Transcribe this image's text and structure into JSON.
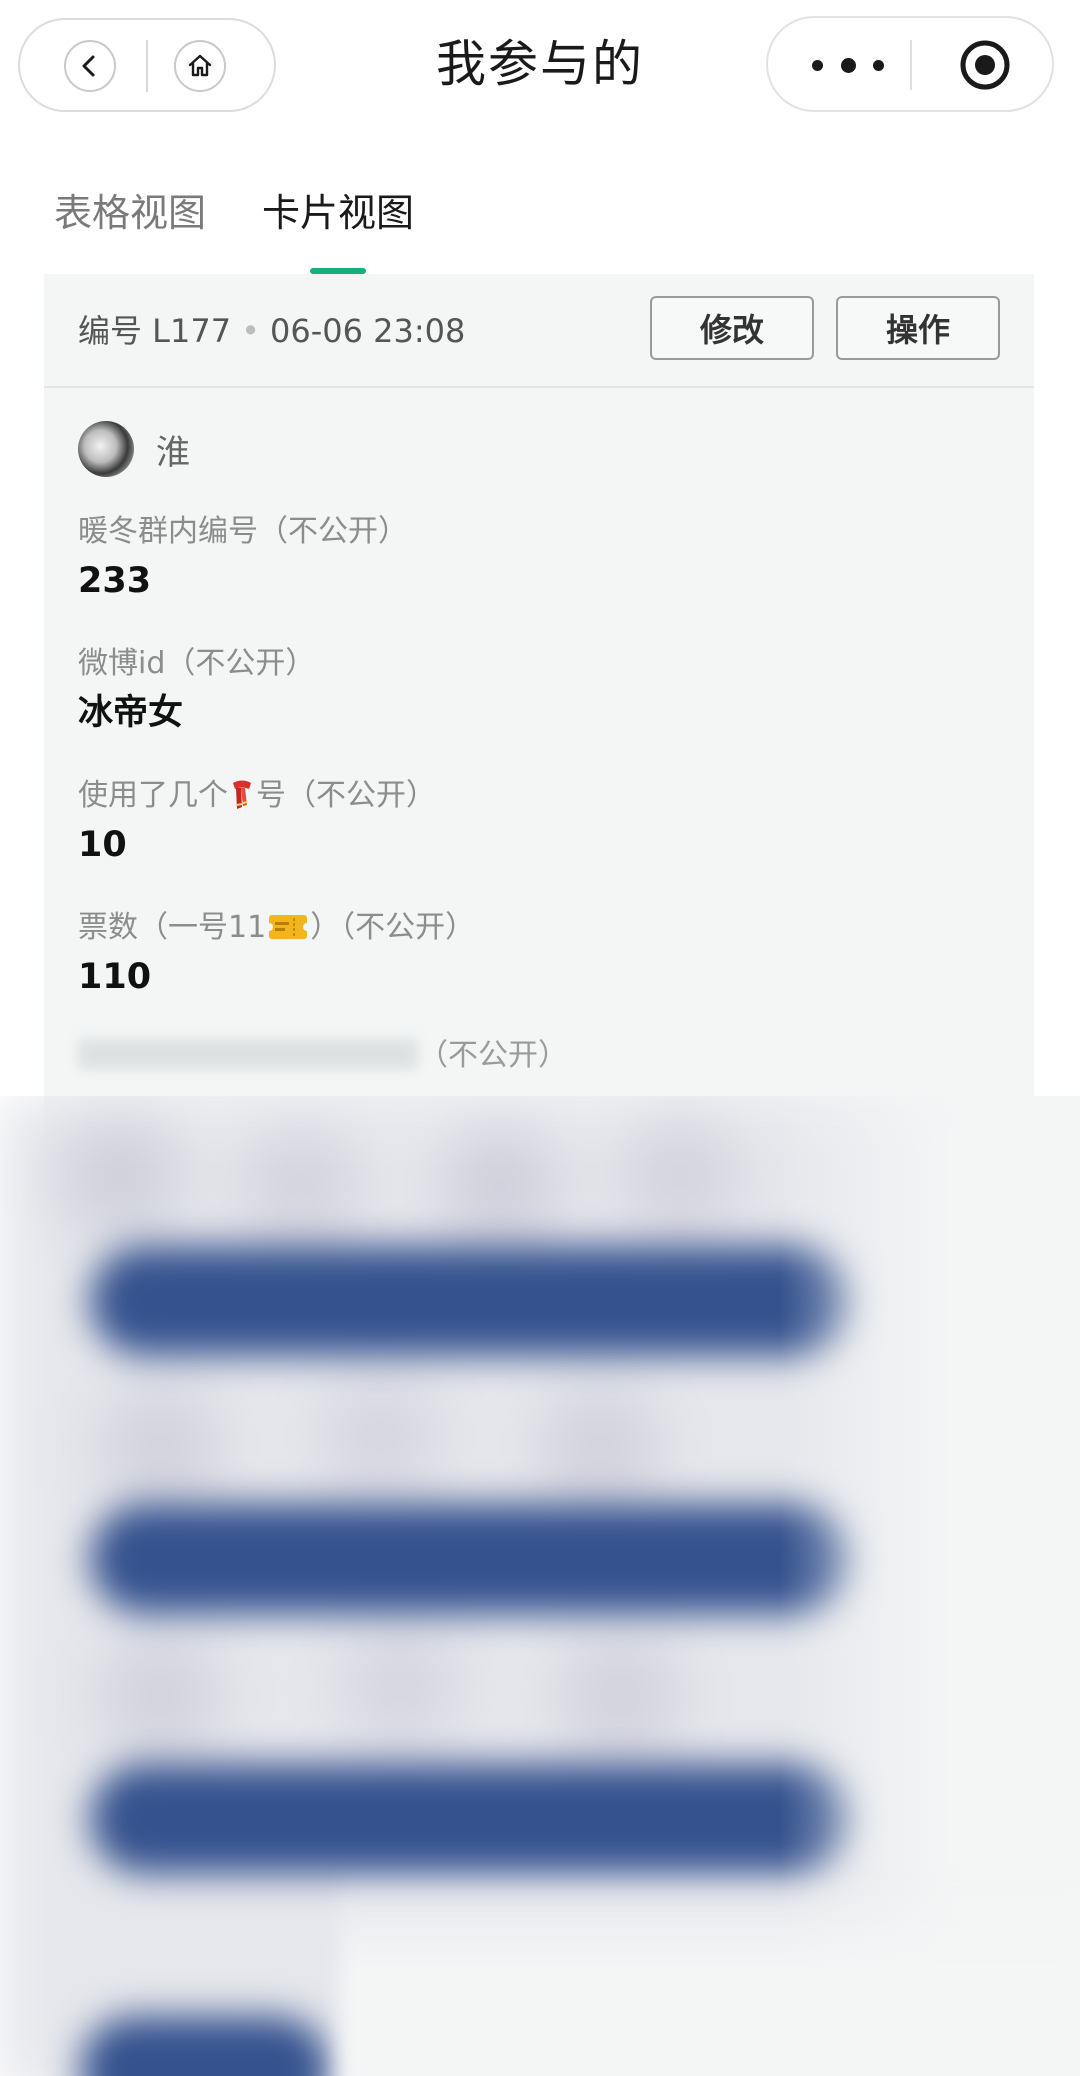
{
  "nav": {
    "title": "我参与的"
  },
  "tabs": [
    {
      "label": "表格视图",
      "active": false
    },
    {
      "label": "卡片视图",
      "active": true
    }
  ],
  "accent_color": "#16b07a",
  "card": {
    "meta_id": "编号 L177",
    "meta_separator": "•",
    "meta_time": "06-06 23:08",
    "edit_label": "修改",
    "ops_label": "操作",
    "user_name": "淮",
    "fields": [
      {
        "label": "暖冬群内编号（不公开）",
        "value": "233"
      },
      {
        "label": "微博id（不公开）",
        "value": "冰帝女"
      },
      {
        "label_before": "使用了几个",
        "label_icon": "scarf-emoji",
        "label_after": "号（不公开）",
        "value": "10"
      },
      {
        "label_before": "票数（一号11",
        "label_icon": "ticket-emoji",
        "label_after": "）（不公开）",
        "value": "110"
      }
    ],
    "blurred_field_suffix": "（不公开）"
  }
}
